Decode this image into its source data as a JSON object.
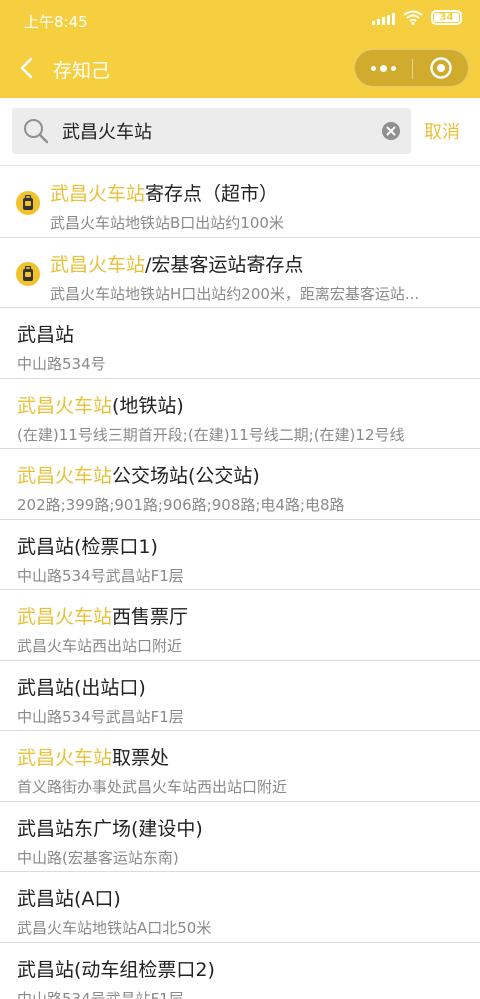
{
  "status_bar": {
    "time": "上午8:45",
    "battery": "34"
  },
  "nav": {
    "title": "存知己"
  },
  "search": {
    "query": "武昌火车站",
    "cancel_label": "取消"
  },
  "results": [
    {
      "icon": "locker-icon",
      "highlight": "武昌火车站",
      "rest": "寄存点（超市）",
      "sub": "武昌火车站地铁站B口出站约100米"
    },
    {
      "icon": "locker-icon",
      "highlight": "武昌火车站",
      "rest": "/宏基客运站寄存点",
      "sub": "武昌火车站地铁站H口出站约200米，距离宏基客运站..."
    },
    {
      "highlight": "",
      "rest": "武昌站",
      "sub": "中山路534号"
    },
    {
      "highlight": "武昌火车站",
      "rest": "(地铁站)",
      "sub": "(在建)11号线三期首开段;(在建)11号线二期;(在建)12号线"
    },
    {
      "highlight": "武昌火车站",
      "rest": "公交场站(公交站)",
      "sub": "202路;399路;901路;906路;908路;电4路;电8路"
    },
    {
      "highlight": "",
      "rest": "武昌站(检票口1)",
      "sub": "中山路534号武昌站F1层"
    },
    {
      "highlight": "武昌火车站",
      "rest": "西售票厅",
      "sub": "武昌火车站西出站口附近"
    },
    {
      "highlight": "",
      "rest": "武昌站(出站口)",
      "sub": "中山路534号武昌站F1层"
    },
    {
      "highlight": "武昌火车站",
      "rest": "取票处",
      "sub": "首义路街办事处武昌火车站西出站口附近"
    },
    {
      "highlight": "",
      "rest": "武昌站东广场(建设中)",
      "sub": "中山路(宏基客运站东南)"
    },
    {
      "highlight": "",
      "rest": "武昌站(A口)",
      "sub": "武昌火车站地铁站A口北50米"
    },
    {
      "highlight": "",
      "rest": "武昌站(动车组检票口2)",
      "sub": "中山路534号武昌站F1层"
    }
  ],
  "colors": {
    "header": "#f5cf3f",
    "highlight": "#e8c13a",
    "subtext": "#8a8a8a"
  }
}
